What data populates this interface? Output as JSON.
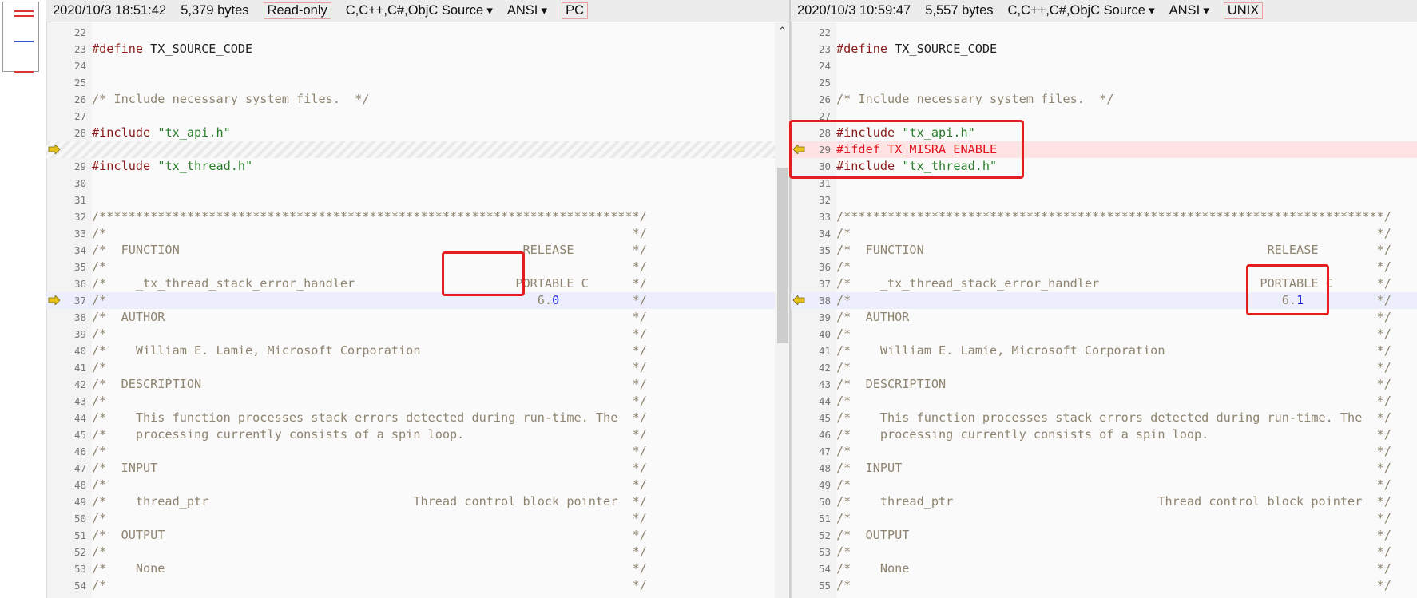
{
  "left": {
    "status": {
      "datetime": "2020/10/3 18:51:42",
      "size": "5,379 bytes",
      "mode": "Read-only",
      "language": "C,C++,C#,ObjC Source",
      "encoding": "ANSI",
      "line_ending": "PC"
    },
    "lines": [
      {
        "n": "22",
        "t": ""
      },
      {
        "n": "23",
        "t": "#define TX_SOURCE_CODE"
      },
      {
        "n": "24",
        "t": ""
      },
      {
        "n": "25",
        "t": ""
      },
      {
        "n": "26",
        "t": "/* Include necessary system files.  */"
      },
      {
        "n": "27",
        "t": ""
      },
      {
        "n": "28",
        "t": "#include \"tx_api.h\""
      },
      {
        "n": "",
        "t": "",
        "kind": "filler",
        "arrow": "right"
      },
      {
        "n": "29",
        "t": "#include \"tx_thread.h\""
      },
      {
        "n": "30",
        "t": ""
      },
      {
        "n": "31",
        "t": ""
      },
      {
        "n": "32",
        "t": "/**************************************************************************/"
      },
      {
        "n": "33",
        "t": "/*                                                                        */"
      },
      {
        "n": "34",
        "t": "/*  FUNCTION                                               RELEASE        */"
      },
      {
        "n": "35",
        "t": "/*                                                                        */"
      },
      {
        "n": "36",
        "t": "/*    _tx_thread_stack_error_handler                      PORTABLE C      */"
      },
      {
        "n": "37",
        "t": "/*                                                           6.0          */",
        "kind": "hl",
        "arrow": "right"
      },
      {
        "n": "38",
        "t": "/*  AUTHOR                                                                */"
      },
      {
        "n": "39",
        "t": "/*                                                                        */"
      },
      {
        "n": "40",
        "t": "/*    William E. Lamie, Microsoft Corporation                             */"
      },
      {
        "n": "41",
        "t": "/*                                                                        */"
      },
      {
        "n": "42",
        "t": "/*  DESCRIPTION                                                           */"
      },
      {
        "n": "43",
        "t": "/*                                                                        */"
      },
      {
        "n": "44",
        "t": "/*    This function processes stack errors detected during run-time. The  */"
      },
      {
        "n": "45",
        "t": "/*    processing currently consists of a spin loop.                       */"
      },
      {
        "n": "46",
        "t": "/*                                                                        */"
      },
      {
        "n": "47",
        "t": "/*  INPUT                                                                 */"
      },
      {
        "n": "48",
        "t": "/*                                                                        */"
      },
      {
        "n": "49",
        "t": "/*    thread_ptr                            Thread control block pointer  */"
      },
      {
        "n": "50",
        "t": "/*                                                                        */"
      },
      {
        "n": "51",
        "t": "/*  OUTPUT                                                                */"
      },
      {
        "n": "52",
        "t": "/*                                                                        */"
      },
      {
        "n": "53",
        "t": "/*    None                                                                */"
      },
      {
        "n": "54",
        "t": "/*                                                                        */"
      }
    ]
  },
  "right": {
    "status": {
      "datetime": "2020/10/3 10:59:47",
      "size": "5,557 bytes",
      "language": "C,C++,C#,ObjC Source",
      "encoding": "ANSI",
      "line_ending": "UNIX"
    },
    "lines": [
      {
        "n": "22",
        "t": ""
      },
      {
        "n": "23",
        "t": "#define TX_SOURCE_CODE"
      },
      {
        "n": "24",
        "t": ""
      },
      {
        "n": "25",
        "t": ""
      },
      {
        "n": "26",
        "t": "/* Include necessary system files.  */"
      },
      {
        "n": "27",
        "t": ""
      },
      {
        "n": "28",
        "t": "#include \"tx_api.h\""
      },
      {
        "n": "29",
        "t": "#ifdef TX_MISRA_ENABLE",
        "kind": "diff",
        "arrow": "left"
      },
      {
        "n": "30",
        "t": "#include \"tx_thread.h\""
      },
      {
        "n": "31",
        "t": ""
      },
      {
        "n": "32",
        "t": ""
      },
      {
        "n": "33",
        "t": "/**************************************************************************/"
      },
      {
        "n": "34",
        "t": "/*                                                                        */"
      },
      {
        "n": "35",
        "t": "/*  FUNCTION                                               RELEASE        */"
      },
      {
        "n": "36",
        "t": "/*                                                                        */"
      },
      {
        "n": "37",
        "t": "/*    _tx_thread_stack_error_handler                      PORTABLE C      */"
      },
      {
        "n": "38",
        "t": "/*                                                           6.1          */",
        "kind": "hl",
        "arrow": "left"
      },
      {
        "n": "39",
        "t": "/*  AUTHOR                                                                */"
      },
      {
        "n": "40",
        "t": "/*                                                                        */"
      },
      {
        "n": "41",
        "t": "/*    William E. Lamie, Microsoft Corporation                             */"
      },
      {
        "n": "42",
        "t": "/*                                                                        */"
      },
      {
        "n": "43",
        "t": "/*  DESCRIPTION                                                           */"
      },
      {
        "n": "44",
        "t": "/*                                                                        */"
      },
      {
        "n": "45",
        "t": "/*    This function processes stack errors detected during run-time. The  */"
      },
      {
        "n": "46",
        "t": "/*    processing currently consists of a spin loop.                       */"
      },
      {
        "n": "47",
        "t": "/*                                                                        */"
      },
      {
        "n": "48",
        "t": "/*  INPUT                                                                 */"
      },
      {
        "n": "49",
        "t": "/*                                                                        */"
      },
      {
        "n": "50",
        "t": "/*    thread_ptr                            Thread control block pointer  */"
      },
      {
        "n": "51",
        "t": "/*                                                                        */"
      },
      {
        "n": "52",
        "t": "/*  OUTPUT                                                                */"
      },
      {
        "n": "53",
        "t": "/*                                                                        */"
      },
      {
        "n": "54",
        "t": "/*    None                                                                */"
      },
      {
        "n": "55",
        "t": "/*                                                                        */"
      }
    ]
  },
  "colors": {
    "diff_text": "#e0141e",
    "diff_bg": "#fde3e3",
    "highlight_bg": "#eceefb",
    "annotation_box": "#e41e1e",
    "arrow": "#e6c21a"
  },
  "icons": {
    "sync_arrow_right": "arrow-right-icon",
    "sync_arrow_left": "arrow-left-icon"
  }
}
